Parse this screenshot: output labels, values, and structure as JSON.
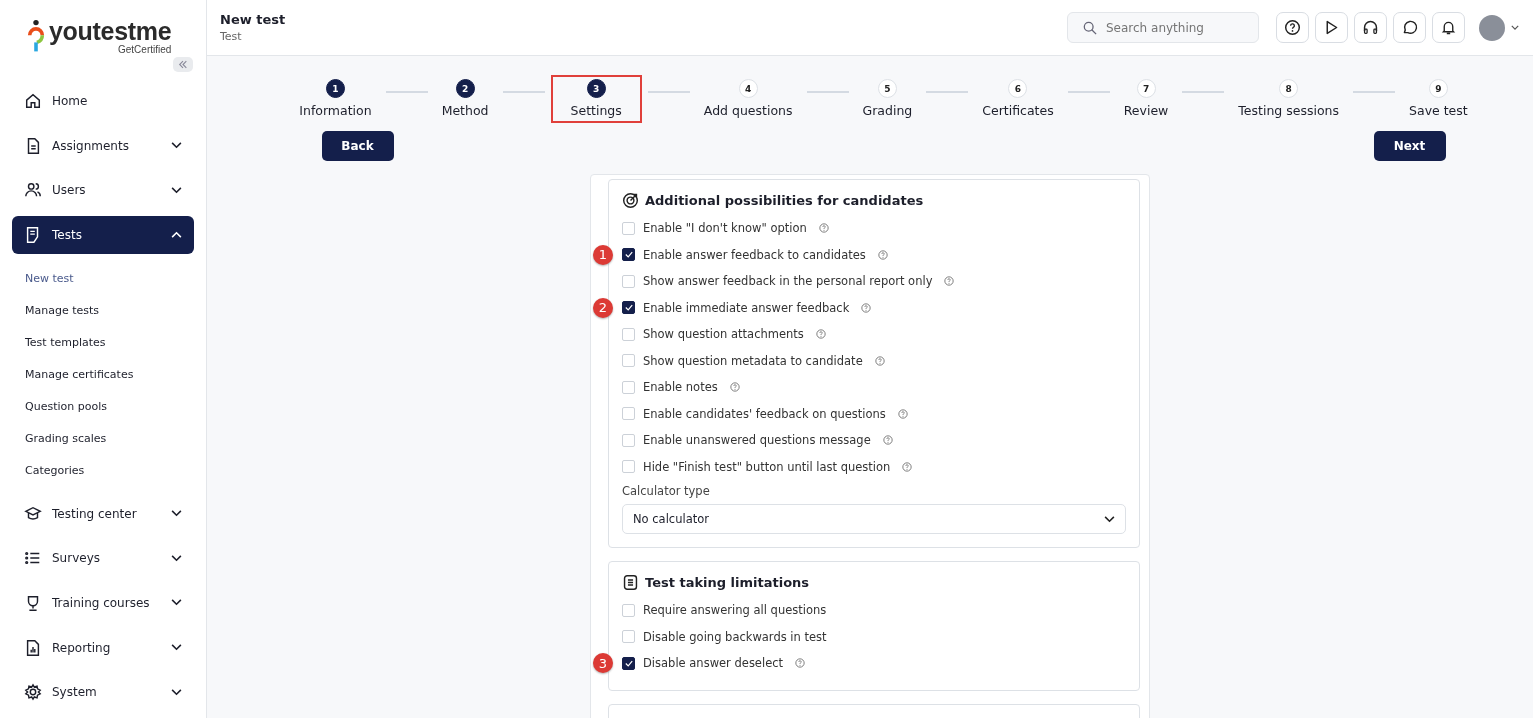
{
  "logo": {
    "name": "youtestme",
    "tagline": "GetCertified"
  },
  "sidebar": {
    "items": [
      {
        "label": "Home",
        "selected": false
      },
      {
        "label": "Assignments",
        "selected": false,
        "expanded": false
      },
      {
        "label": "Users",
        "selected": false,
        "expanded": false
      },
      {
        "label": "Tests",
        "selected": true,
        "expanded": true,
        "children": [
          {
            "label": "New test",
            "selected": true
          },
          {
            "label": "Manage tests",
            "selected": false
          },
          {
            "label": "Test templates",
            "selected": false
          },
          {
            "label": "Manage certificates",
            "selected": false
          },
          {
            "label": "Question pools",
            "selected": false
          },
          {
            "label": "Grading scales",
            "selected": false
          },
          {
            "label": "Categories",
            "selected": false
          }
        ]
      },
      {
        "label": "Testing center",
        "selected": false,
        "expanded": false
      },
      {
        "label": "Surveys",
        "selected": false,
        "expanded": false
      },
      {
        "label": "Training courses",
        "selected": false,
        "expanded": false
      },
      {
        "label": "Reporting",
        "selected": false,
        "expanded": false
      },
      {
        "label": "System",
        "selected": false,
        "expanded": false
      }
    ]
  },
  "header": {
    "title": "New test",
    "subtitle": "Test",
    "search": {
      "placeholder": "Search anything"
    }
  },
  "steps": [
    {
      "number": "1",
      "label": "Information",
      "done": true,
      "highlighted": false
    },
    {
      "number": "2",
      "label": "Method",
      "done": true,
      "highlighted": false
    },
    {
      "number": "3",
      "label": "Settings",
      "done": true,
      "highlighted": true
    },
    {
      "number": "4",
      "label": "Add questions",
      "done": false,
      "highlighted": false
    },
    {
      "number": "5",
      "label": "Grading",
      "done": false,
      "highlighted": false
    },
    {
      "number": "6",
      "label": "Certificates",
      "done": false,
      "highlighted": false
    },
    {
      "number": "7",
      "label": "Review",
      "done": false,
      "highlighted": false
    },
    {
      "number": "8",
      "label": "Testing sessions",
      "done": false,
      "highlighted": false
    },
    {
      "number": "9",
      "label": "Save test",
      "done": false,
      "highlighted": false
    }
  ],
  "buttons": {
    "back": "Back",
    "next": "Next"
  },
  "sections": [
    {
      "title": "Additional possibilities for candidates",
      "options": [
        {
          "label": "Enable \"I don't know\" option",
          "checked": false,
          "help": true
        },
        {
          "label": "Enable answer feedback to candidates",
          "checked": true,
          "help": true,
          "marker": "1"
        },
        {
          "label": "Show answer feedback in the personal report only",
          "checked": false,
          "help": true
        },
        {
          "label": "Enable immediate answer feedback",
          "checked": true,
          "help": true,
          "marker": "2"
        },
        {
          "label": "Show question attachments",
          "checked": false,
          "help": true
        },
        {
          "label": "Show question metadata to candidate",
          "checked": false,
          "help": true
        },
        {
          "label": "Enable notes",
          "checked": false,
          "help": true
        },
        {
          "label": "Enable candidates' feedback on questions",
          "checked": false,
          "help": true
        },
        {
          "label": "Enable unanswered questions message",
          "checked": false,
          "help": true
        },
        {
          "label": "Hide \"Finish test\" button until last question",
          "checked": false,
          "help": true
        }
      ],
      "select": {
        "label": "Calculator type",
        "value": "No calculator"
      }
    },
    {
      "title": "Test taking limitations",
      "options": [
        {
          "label": "Require answering all questions",
          "checked": false,
          "help": false
        },
        {
          "label": "Disable going backwards in test",
          "checked": false,
          "help": false
        },
        {
          "label": "Disable answer deselect",
          "checked": true,
          "help": true,
          "marker": "3"
        }
      ]
    }
  ]
}
